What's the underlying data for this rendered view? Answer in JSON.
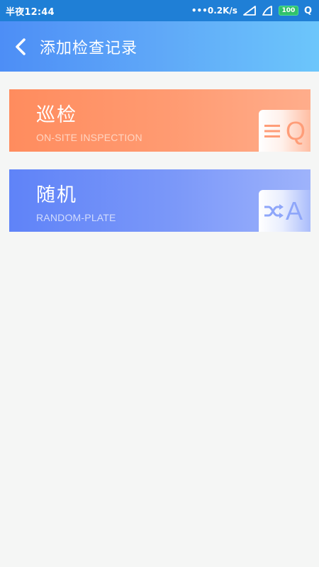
{
  "status_bar": {
    "time": "半夜12:44",
    "net_speed": "0.2K/s",
    "battery": "100",
    "q_label": "Q"
  },
  "header": {
    "title": "添加检查记录"
  },
  "cards": {
    "inspection": {
      "title": "巡检",
      "subtitle": "ON-SITE INSPECTION",
      "badge_letter": "Q",
      "icon": "list-icon",
      "color": "#ff8c5e"
    },
    "random": {
      "title": "随机",
      "subtitle": "RANDOM-PLATE",
      "badge_letter": "A",
      "icon": "shuffle-icon",
      "color": "#5f83f8"
    }
  },
  "colors": {
    "status_bar": "#1f7fd6",
    "header_start": "#4d8ef6",
    "header_end": "#6cc6fb",
    "background": "#f5f6f5"
  }
}
